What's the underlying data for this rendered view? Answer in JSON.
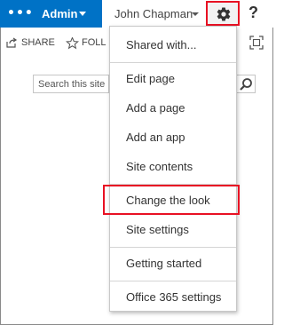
{
  "topbar": {
    "app_launcher_icon": "waffle-dots",
    "admin_label": "Admin",
    "user_name": "John Chapman",
    "settings_icon": "gear-icon",
    "help_label": "?"
  },
  "toolbar": {
    "share_label": "SHARE",
    "follow_label": "FOLLOW",
    "focus_icon": "focus-on-content-icon"
  },
  "search": {
    "placeholder": "Search this site"
  },
  "menu": {
    "items": [
      {
        "label": "Shared with..."
      },
      {
        "label": "Edit page"
      },
      {
        "label": "Add a page"
      },
      {
        "label": "Add an app"
      },
      {
        "label": "Site contents"
      },
      {
        "label": "Change the look"
      },
      {
        "label": "Site settings"
      },
      {
        "label": "Getting started"
      },
      {
        "label": "Office 365 settings"
      }
    ]
  },
  "colors": {
    "brand_blue": "#0072c6",
    "highlight_red": "#e81123"
  }
}
